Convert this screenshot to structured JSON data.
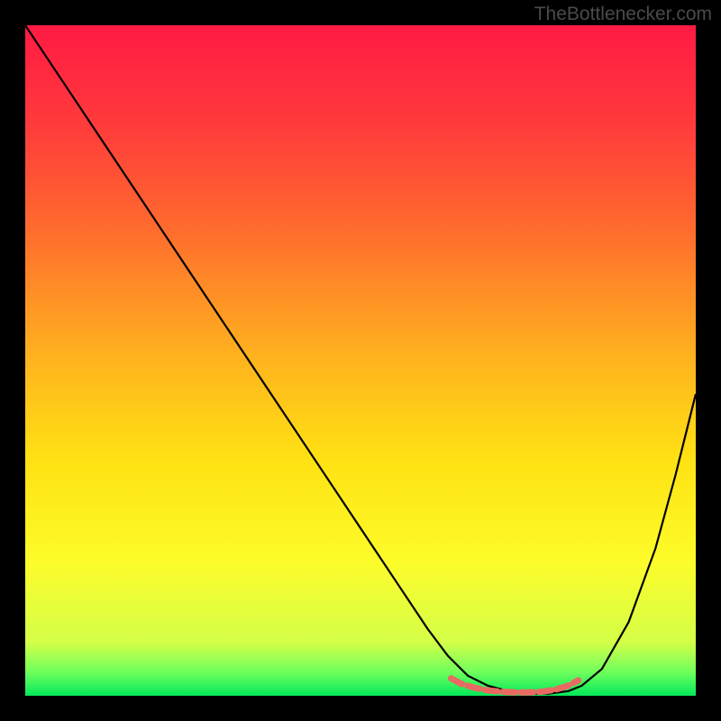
{
  "watermark": "TheBottlenecker.com",
  "chart_data": {
    "type": "line",
    "title": "",
    "xlabel": "",
    "ylabel": "",
    "xlim": [
      0,
      100
    ],
    "ylim": [
      0,
      100
    ],
    "grid": false,
    "legend": false,
    "background_gradient": {
      "stops": [
        {
          "offset": 0.0,
          "color": "#ff1a44"
        },
        {
          "offset": 0.15,
          "color": "#ff3b3b"
        },
        {
          "offset": 0.3,
          "color": "#ff6a2e"
        },
        {
          "offset": 0.5,
          "color": "#ffb41e"
        },
        {
          "offset": 0.65,
          "color": "#ffe213"
        },
        {
          "offset": 0.8,
          "color": "#fdfc2a"
        },
        {
          "offset": 0.92,
          "color": "#d4ff48"
        },
        {
          "offset": 0.965,
          "color": "#6eff5c"
        },
        {
          "offset": 1.0,
          "color": "#04e85a"
        }
      ]
    },
    "series": [
      {
        "name": "bottleneck-curve",
        "color": "#000000",
        "x": [
          0.0,
          5,
          10,
          15,
          20,
          25,
          30,
          35,
          40,
          45,
          50,
          55,
          60,
          63,
          66,
          69,
          72,
          75,
          78,
          81,
          83,
          86,
          90,
          94,
          97,
          100
        ],
        "y": [
          100,
          92.5,
          85,
          77.5,
          70,
          62.5,
          55,
          47.5,
          40,
          32.5,
          25,
          17.5,
          10,
          6,
          3,
          1.5,
          0.7,
          0.3,
          0.3,
          0.7,
          1.5,
          4,
          11,
          22,
          33,
          45
        ]
      },
      {
        "name": "optimal-zone-marker",
        "color": "#e86a63",
        "stroke_width": 7,
        "x": [
          63.5,
          65,
          67,
          69,
          71,
          73,
          75,
          77,
          79,
          81,
          82.5
        ],
        "y": [
          2.6,
          1.8,
          1.2,
          0.8,
          0.6,
          0.5,
          0.5,
          0.6,
          0.9,
          1.5,
          2.3
        ]
      }
    ]
  }
}
